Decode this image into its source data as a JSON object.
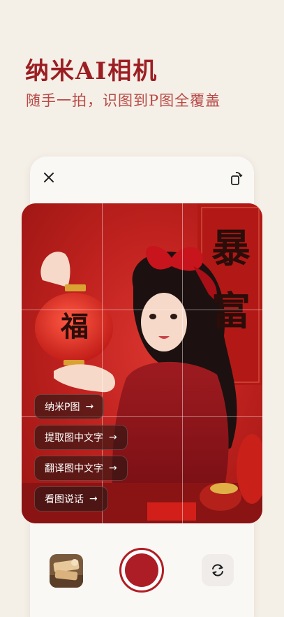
{
  "header": {
    "title": "纳米AI相机",
    "subtitle": "随手一拍，识图到P图全覆盖"
  },
  "icons": {
    "close": "close-icon",
    "rotate": "rotate-screen-icon",
    "switch_camera": "camera-switch-icon"
  },
  "scene": {
    "lantern_char": "福",
    "banner_text": "暴富"
  },
  "actions": [
    {
      "label": "纳米P图",
      "arrow": "→"
    },
    {
      "label": "提取图中文字",
      "arrow": "→"
    },
    {
      "label": "翻译图中文字",
      "arrow": "→"
    },
    {
      "label": "看图说话",
      "arrow": "→"
    }
  ],
  "colors": {
    "accent": "#9c1e22",
    "subtitle": "#b84a47",
    "shutter": "#ad1d25",
    "background": "#f4efe7"
  }
}
